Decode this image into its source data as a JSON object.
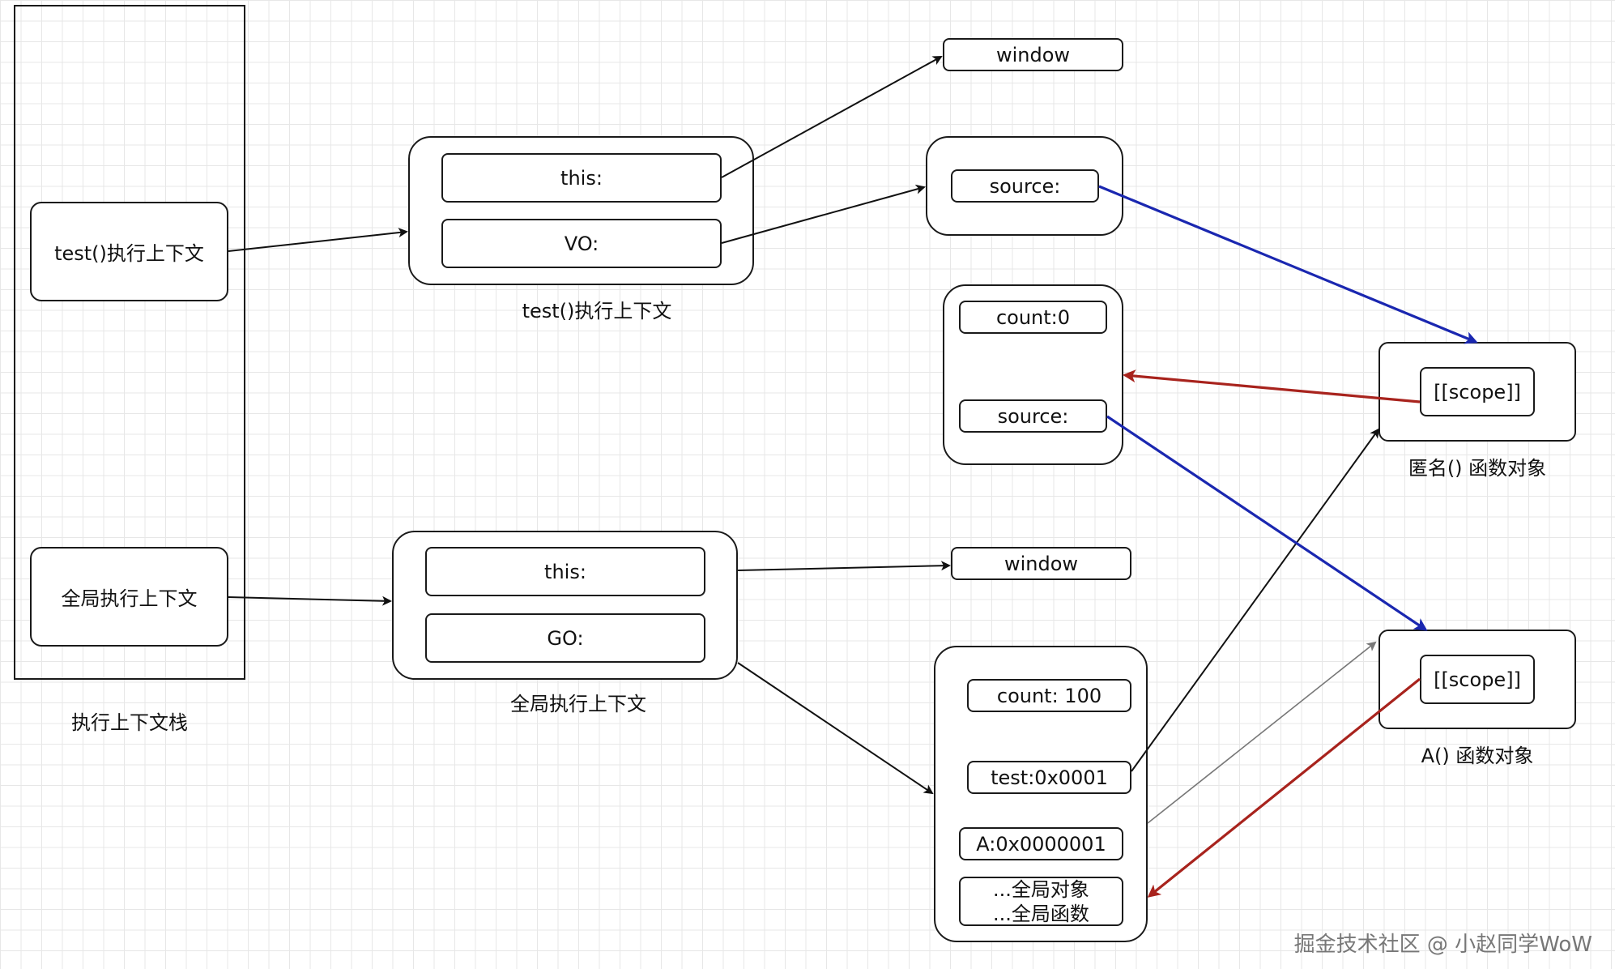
{
  "stack": {
    "label": "执行上下文栈",
    "items": [
      "test()执行上下文",
      "全局执行上下文"
    ]
  },
  "test_ctx": {
    "label": "test()执行上下文",
    "this": "this:",
    "vo": "VO:"
  },
  "global_ctx": {
    "label": "全局执行上下文",
    "this": "this:",
    "go": "GO:"
  },
  "window_top": "window",
  "window_bottom": "window",
  "vo_object": {
    "source": "source:"
  },
  "closure_scope": {
    "count": "count:0",
    "source": "source:"
  },
  "global_object": {
    "count": "count: 100",
    "test": "test:0x0001",
    "a": "A:0x0000001",
    "rest_line1": "...全局对象",
    "rest_line2": "...全局函数"
  },
  "anon_func": {
    "scope": "[[scope]]",
    "label": "匿名() 函数对象"
  },
  "a_func": {
    "scope": "[[scope]]",
    "label": "A() 函数对象"
  },
  "watermark": "掘金技术社区 @ 小赵同学WoW",
  "colors": {
    "blue": "#1a27b0",
    "red": "#a8231d",
    "gray": "#777777",
    "black": "#111111"
  }
}
